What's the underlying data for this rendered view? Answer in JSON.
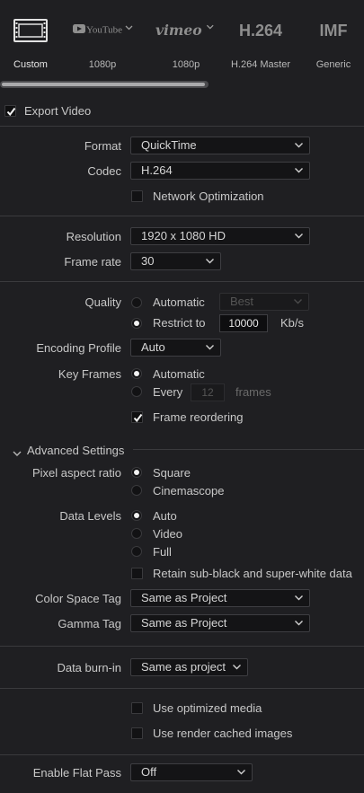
{
  "presets": [
    {
      "name": "custom",
      "logo": "filmstrip-icon",
      "label": "Custom",
      "active": true
    },
    {
      "name": "youtube",
      "logo_text": "YouTube",
      "label": "1080p",
      "has_menu": true
    },
    {
      "name": "vimeo",
      "logo_text": "vimeo",
      "label": "1080p",
      "has_menu": true
    },
    {
      "name": "h264",
      "logo_text": "H.264",
      "label": "H.264 Master"
    },
    {
      "name": "imf",
      "logo_text": "IMF",
      "label": "Generic"
    }
  ],
  "export_video": {
    "label": "Export Video",
    "checked": true
  },
  "format": {
    "label": "Format",
    "value": "QuickTime"
  },
  "codec": {
    "label": "Codec",
    "value": "H.264"
  },
  "network_optimization": {
    "label": "Network Optimization",
    "checked": false
  },
  "resolution": {
    "label": "Resolution",
    "value": "1920 x 1080 HD"
  },
  "frame_rate": {
    "label": "Frame rate",
    "value": "30"
  },
  "quality": {
    "label": "Quality",
    "automatic_label": "Automatic",
    "automatic_value": "Best",
    "restrict_label": "Restrict to",
    "restrict_value": "10000",
    "restrict_unit": "Kb/s",
    "selected": "restrict"
  },
  "encoding_profile": {
    "label": "Encoding Profile",
    "value": "Auto"
  },
  "key_frames": {
    "label": "Key Frames",
    "automatic_label": "Automatic",
    "every_label": "Every",
    "every_value": "12",
    "every_unit": "frames",
    "selected": "automatic"
  },
  "frame_reordering": {
    "label": "Frame reordering",
    "checked": true
  },
  "advanced": {
    "label": "Advanced Settings",
    "expanded": true
  },
  "pixel_aspect": {
    "label": "Pixel aspect ratio",
    "opt1": "Square",
    "opt2": "Cinemascope",
    "selected": "Square"
  },
  "data_levels": {
    "label": "Data Levels",
    "opt1": "Auto",
    "opt2": "Video",
    "opt3": "Full",
    "selected": "Auto"
  },
  "retain_subblack": {
    "label": "Retain sub-black and super-white data",
    "checked": false
  },
  "color_space_tag": {
    "label": "Color Space Tag",
    "value": "Same as Project"
  },
  "gamma_tag": {
    "label": "Gamma Tag",
    "value": "Same as Project"
  },
  "data_burn_in": {
    "label": "Data burn-in",
    "value": "Same as project"
  },
  "use_optimized_media": {
    "label": "Use optimized media",
    "checked": false
  },
  "use_render_cached": {
    "label": "Use render cached images",
    "checked": false
  },
  "enable_flat_pass": {
    "label": "Enable Flat Pass",
    "value": "Off"
  },
  "colors": {
    "background": "#1f1f22",
    "text": "#c8c8c8",
    "control_bg": "#141416",
    "accent": "#f2f2f2"
  }
}
